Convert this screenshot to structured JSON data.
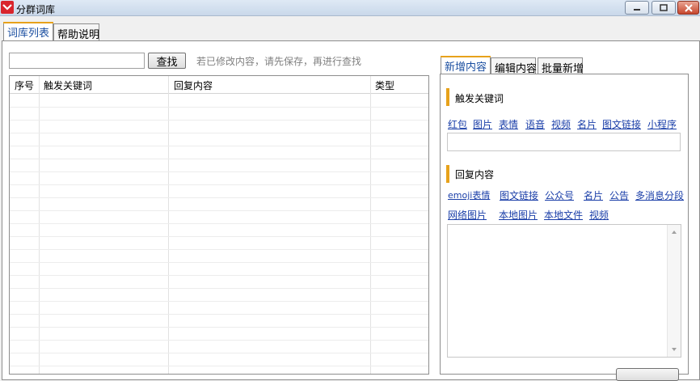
{
  "window": {
    "title": "分群词库"
  },
  "main_tabs": [
    {
      "label": "词库列表"
    },
    {
      "label": "帮助说明"
    }
  ],
  "search": {
    "value": "",
    "button_label": "查找",
    "hint": "若已修改内容，请先保存，再进行查找"
  },
  "table": {
    "columns": [
      "序号",
      "触发关键词",
      "回复内容",
      "类型"
    ],
    "rows": []
  },
  "right_tabs": [
    {
      "label": "新增内容"
    },
    {
      "label": "编辑内容"
    },
    {
      "label": "批量新增"
    }
  ],
  "keyword_section": {
    "title": "触发关键词",
    "links": [
      "红包",
      "图片",
      "表情",
      "语音",
      "视频",
      "名片",
      "图文链接",
      "小程序"
    ],
    "value": ""
  },
  "reply_section": {
    "title": "回复内容",
    "links_row1": [
      "emoji表情",
      "图文链接",
      "公众号",
      "名片",
      "公告",
      "多消息分段"
    ],
    "links_row2": [
      "网络图片",
      "本地图片",
      "本地文件",
      "视频"
    ],
    "value": ""
  },
  "colors": {
    "accent": "#e7a21b",
    "link": "#1a3ea8",
    "brand": "#d9252c"
  }
}
